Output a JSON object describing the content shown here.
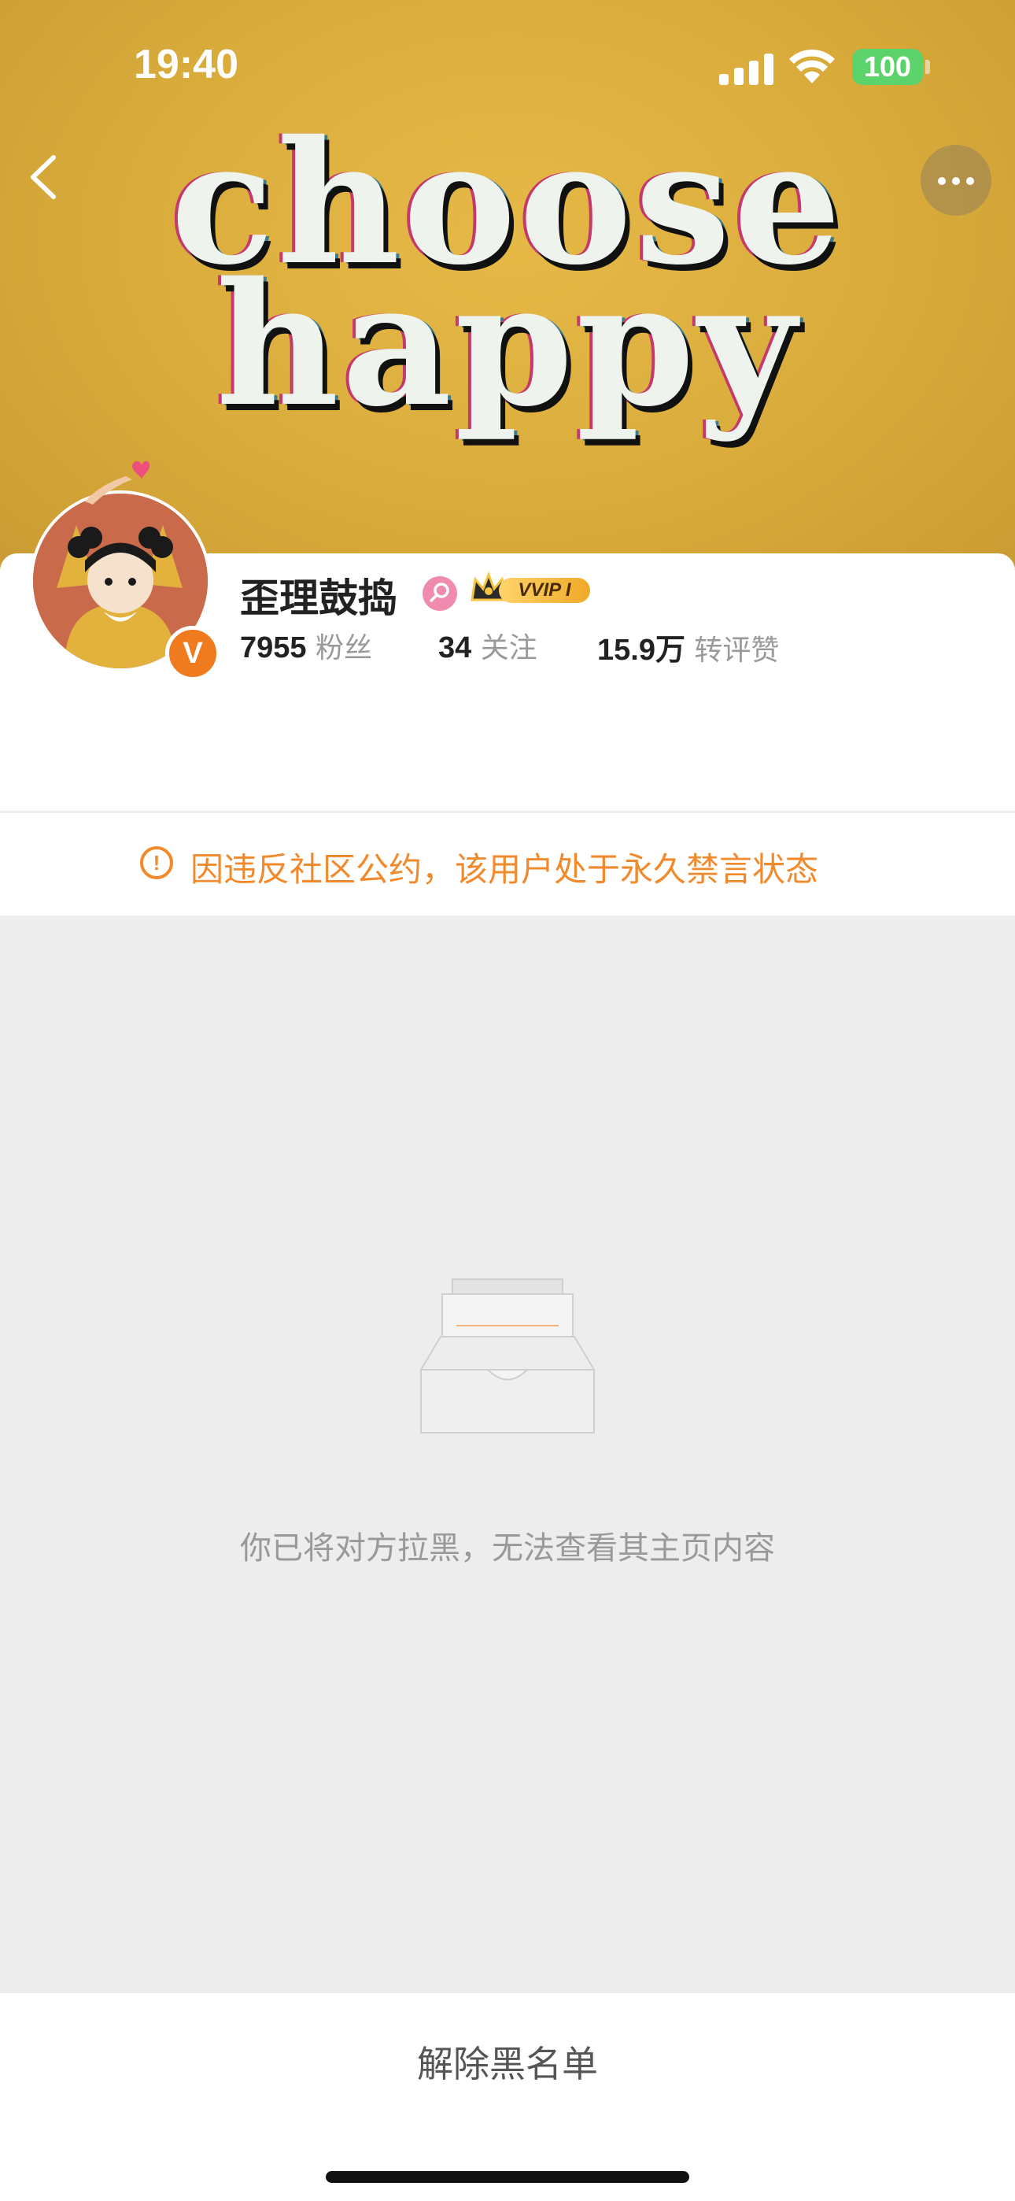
{
  "status_bar": {
    "time": "19:40",
    "battery": "100"
  },
  "banner": {
    "line1": "choose",
    "line2": "happy"
  },
  "profile": {
    "name": "歪理鼓捣",
    "verified_badge": "V",
    "vip_label": "VVIP I",
    "stats": [
      {
        "value": "7955",
        "label": "粉丝"
      },
      {
        "value": "34",
        "label": "关注"
      },
      {
        "value": "15.9万",
        "label": "转评赞"
      }
    ]
  },
  "notice": {
    "icon": "!",
    "text": "因违反社区公约，该用户处于永久禁言状态"
  },
  "empty_state": {
    "text": "你已将对方拉黑，无法查看其主页内容"
  },
  "actions": {
    "unblock_label": "解除黑名单"
  },
  "colors": {
    "accent": "#f08a2c",
    "verified": "#f07a1e",
    "battery": "#5bd36a"
  }
}
